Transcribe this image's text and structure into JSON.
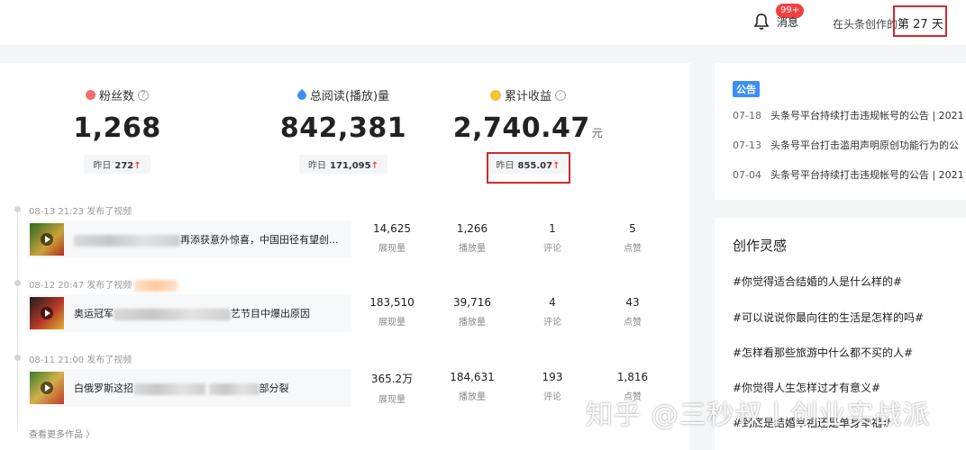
{
  "header": {
    "messages_label": "消息",
    "messages_badge": "99+",
    "days_prefix": "在头条创作的",
    "days_text": "第 27 天"
  },
  "stats": [
    {
      "label": "粉丝数",
      "value": "1,268",
      "unit": "",
      "yday_label": "昨日",
      "yday_value": "272"
    },
    {
      "label": "总阅读(播放)量",
      "value": "842,381",
      "unit": "",
      "yday_label": "昨日",
      "yday_value": "171,095"
    },
    {
      "label": "累计收益",
      "value": "2,740.47",
      "unit": "元",
      "yday_label": "昨日",
      "yday_value": "855.07"
    }
  ],
  "posts": [
    {
      "meta": "08-13 21:23 发布了视频",
      "title_visible": "再添获意外惊喜，中国田径有望创...",
      "metrics": [
        {
          "value": "14,625",
          "label": "展现量"
        },
        {
          "value": "1,266",
          "label": "播放量"
        },
        {
          "value": "1",
          "label": "评论"
        },
        {
          "value": "5",
          "label": "点赞"
        }
      ]
    },
    {
      "meta": "08-12 20:47 发布了视频",
      "title_prefix": "奥运冠军",
      "title_visible": "艺节目中爆出原因",
      "metrics": [
        {
          "value": "183,510",
          "label": "展现量"
        },
        {
          "value": "39,716",
          "label": "播放量"
        },
        {
          "value": "4",
          "label": "评论"
        },
        {
          "value": "43",
          "label": "点赞"
        }
      ]
    },
    {
      "meta": "08-11 21:00 发布了视频",
      "title_prefix": "白俄罗斯这招",
      "title_visible": "部分裂",
      "metrics": [
        {
          "value": "365.2万",
          "label": "展现量"
        },
        {
          "value": "184,631",
          "label": "播放量"
        },
        {
          "value": "193",
          "label": "评论"
        },
        {
          "value": "1,816",
          "label": "点赞"
        }
      ]
    }
  ],
  "more_works": "查看更多作品 〉",
  "notice": {
    "tag": "公告",
    "items": [
      {
        "date": "07-18",
        "text": "头条号平台持续打击违规帐号的公告 | 2021"
      },
      {
        "date": "07-13",
        "text": "头条号平台打击滥用声明原创功能行为的公"
      },
      {
        "date": "07-04",
        "text": "头条号平台持续打击违规帐号的公告 | 2021"
      }
    ]
  },
  "inspiration": {
    "title": "创作灵感",
    "topics": [
      "#你觉得适合结婚的人是什么样的#",
      "#可以说说你最向往的生活是怎样的吗#",
      "#怎样看那些旅游中什么都不买的人#",
      "#你觉得人生怎样过才有意义#",
      "#到底是结婚幸福还是单身幸福#"
    ]
  },
  "watermark": "知乎 @三秒叔丨创业实战派"
}
